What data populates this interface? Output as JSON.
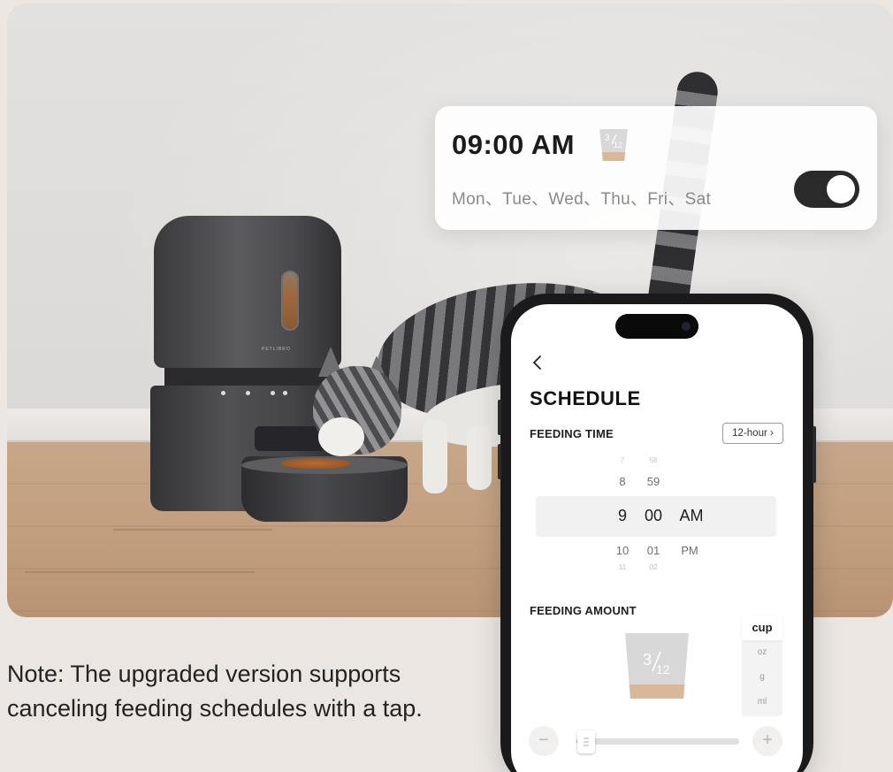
{
  "schedule_card": {
    "time": "09:00 AM",
    "portion_numerator": "3",
    "portion_denominator": "12",
    "days": "Mon、Tue、Wed、Thu、Fri、Sat",
    "toggle_on": true
  },
  "feeder": {
    "brand": "PETLIBRO"
  },
  "note": {
    "line1": "Note: The upgraded version supports",
    "line2": "canceling feeding schedules with a tap."
  },
  "app": {
    "title": "SCHEDULE",
    "feeding_time_label": "FEEDING TIME",
    "hour_format": "12-hour ›",
    "picker": {
      "above_far": [
        "7",
        "58"
      ],
      "above": [
        "8",
        "59"
      ],
      "selected": {
        "hour": "9",
        "minute": "00",
        "period": "AM"
      },
      "below": [
        "10",
        "01",
        "PM"
      ],
      "below_far": [
        "11",
        "02"
      ]
    },
    "feeding_amount_label": "FEEDING AMOUNT",
    "amount_numerator": "3",
    "amount_denominator": "12",
    "units": [
      "cup",
      "oz",
      "g",
      "ml"
    ],
    "selected_unit": "cup",
    "minus_label": "−",
    "plus_label": "+",
    "amount_level": 0.06
  },
  "colors": {
    "food_fill": "#d9b79a",
    "cup_gray": "#d8d8d8",
    "toggle_on": "#2a2a2a"
  }
}
